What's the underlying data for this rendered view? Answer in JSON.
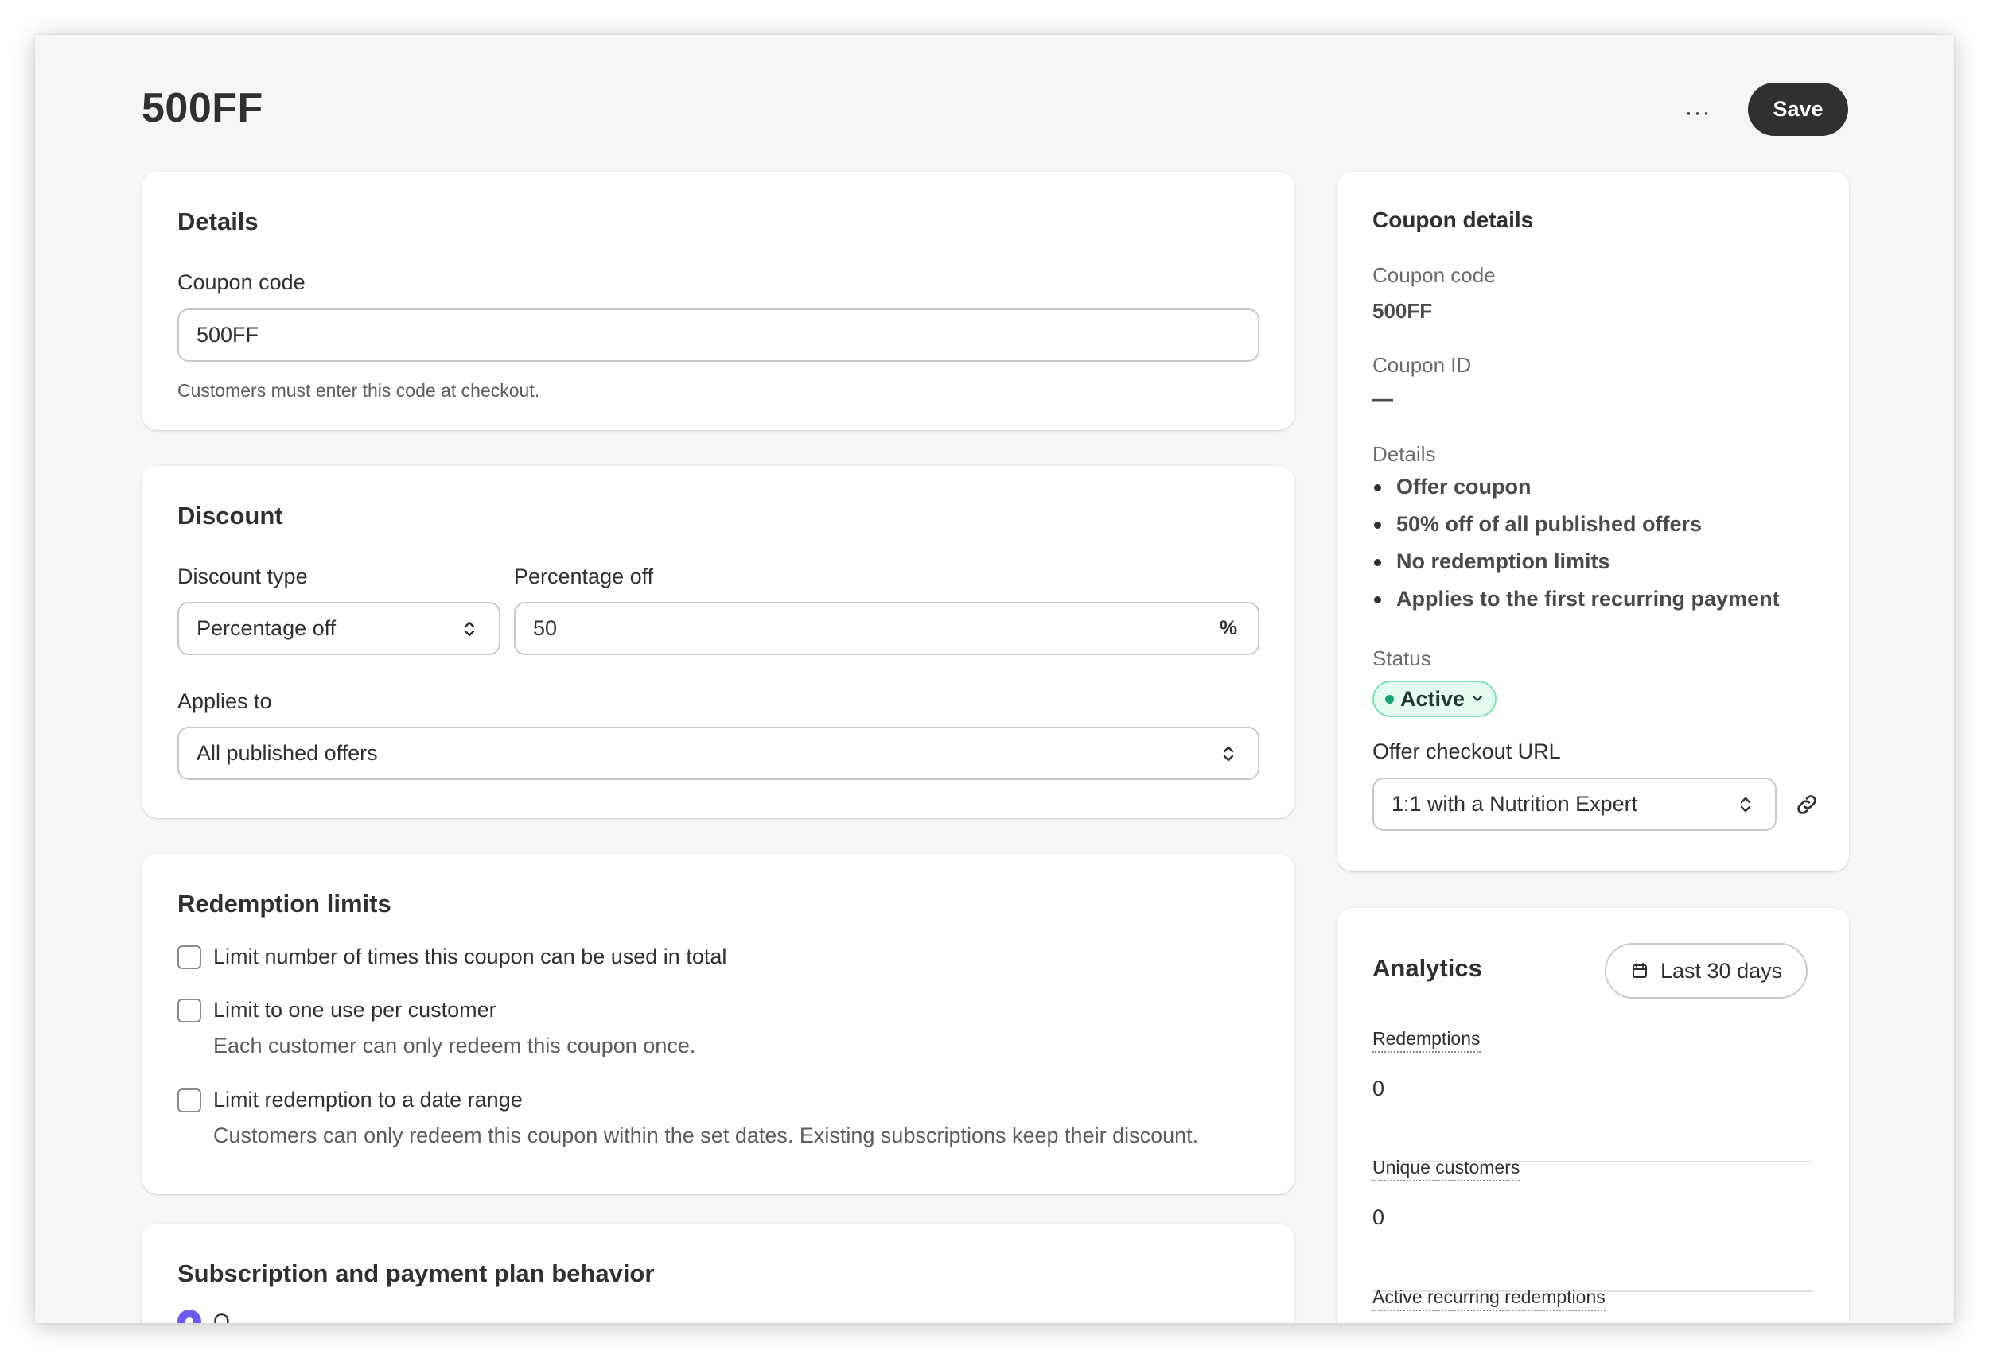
{
  "header": {
    "title": "500FF",
    "more_label": "···",
    "save_label": "Save"
  },
  "details_card": {
    "title": "Details",
    "coupon_code_label": "Coupon code",
    "coupon_code_value": "500FF",
    "coupon_code_help": "Customers must enter this code at checkout."
  },
  "discount_card": {
    "title": "Discount",
    "discount_type_label": "Discount type",
    "discount_type_value": "Percentage off",
    "percentage_label": "Percentage off",
    "percentage_value": "50",
    "percentage_suffix": "%",
    "applies_to_label": "Applies to",
    "applies_to_value": "All published offers"
  },
  "redemption_card": {
    "title": "Redemption limits",
    "options": [
      {
        "label": "Limit number of times this coupon can be used in total",
        "checked": false
      },
      {
        "label": "Limit to one use per customer",
        "description": "Each customer can only redeem this coupon once.",
        "checked": false
      },
      {
        "label": "Limit redemption to a date range",
        "description": "Customers can only redeem this coupon within the set dates. Existing subscriptions keep their discount.",
        "checked": false
      }
    ]
  },
  "subscription_card": {
    "title": "Subscription and payment plan behavior",
    "first_option_partial": "O"
  },
  "coupon_details": {
    "title": "Coupon details",
    "code_label": "Coupon code",
    "code_value": "500FF",
    "id_label": "Coupon ID",
    "id_value": "—",
    "details_label": "Details",
    "details_items": [
      "Offer coupon",
      "50% off of all published offers",
      "No redemption limits",
      "Applies to the first recurring payment"
    ],
    "status_label": "Status",
    "status_value": "Active",
    "status_color": "#13a46a",
    "checkout_url_label": "Offer checkout URL",
    "checkout_url_value": "1:1 with a Nutrition Expert"
  },
  "analytics": {
    "title": "Analytics",
    "date_range": "Last 30 days",
    "metrics": [
      {
        "label": "Redemptions",
        "value": "0"
      },
      {
        "label": "Unique customers",
        "value": "0"
      },
      {
        "label": "Active recurring redemptions",
        "value": ""
      }
    ]
  },
  "colors": {
    "primary_button": "#303030",
    "status_badge_bg": "#e6fbef",
    "status_badge_border": "#7ee2b0",
    "radio_accent": "#6b5cf0"
  }
}
